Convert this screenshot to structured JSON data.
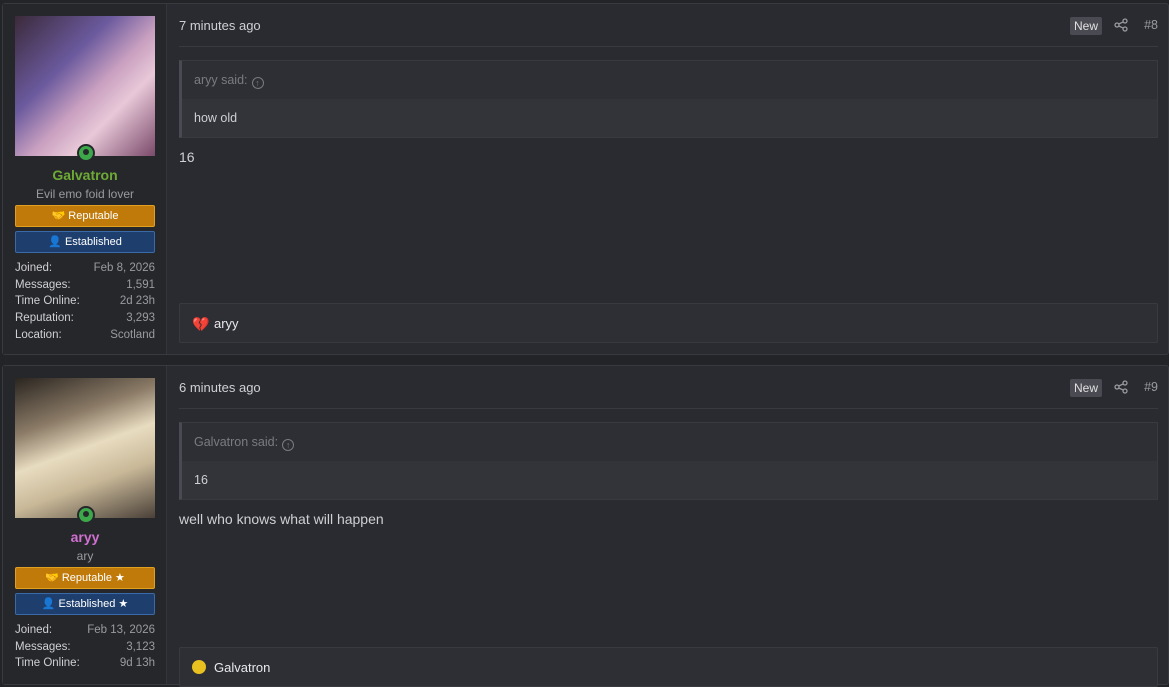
{
  "posts": [
    {
      "user": {
        "name": "Galvatron",
        "title": "Evil emo foid lover",
        "banner_rep": "Reputable",
        "banner_est": "Established",
        "stats": [
          {
            "key": "Joined:",
            "value": "Feb 8, 2026"
          },
          {
            "key": "Messages:",
            "value": "1,591"
          },
          {
            "key": "Time Online:",
            "value": "2d 23h"
          },
          {
            "key": "Reputation:",
            "value": "3,293"
          },
          {
            "key": "Location:",
            "value": "Scotland"
          }
        ]
      },
      "time": "7 minutes ago",
      "badge": "New",
      "number": "#8",
      "quote_author": "aryy said:",
      "quote_text": "how old",
      "body": "16",
      "reaction_user": "aryy"
    },
    {
      "user": {
        "name": "aryy",
        "title": "ary",
        "banner_rep": "Reputable ★",
        "banner_est": "Established ★",
        "stats": [
          {
            "key": "Joined:",
            "value": "Feb 13, 2026"
          },
          {
            "key": "Messages:",
            "value": "3,123"
          },
          {
            "key": "Time Online:",
            "value": "9d 13h"
          }
        ]
      },
      "time": "6 minutes ago",
      "badge": "New",
      "number": "#9",
      "quote_author": "Galvatron said:",
      "quote_text": "16",
      "body": "well who knows what will happen",
      "reaction_user": "Galvatron"
    }
  ],
  "icons": {
    "heart": "broken-heart-icon",
    "smile": "smile-icon",
    "share": "share-icon",
    "online": "online-status-icon"
  },
  "colors": {
    "username_1": "#6dab34",
    "username_2": "#d070d0",
    "reputable_banner": "#c07a0a",
    "established_banner": "#1e3f6e"
  }
}
